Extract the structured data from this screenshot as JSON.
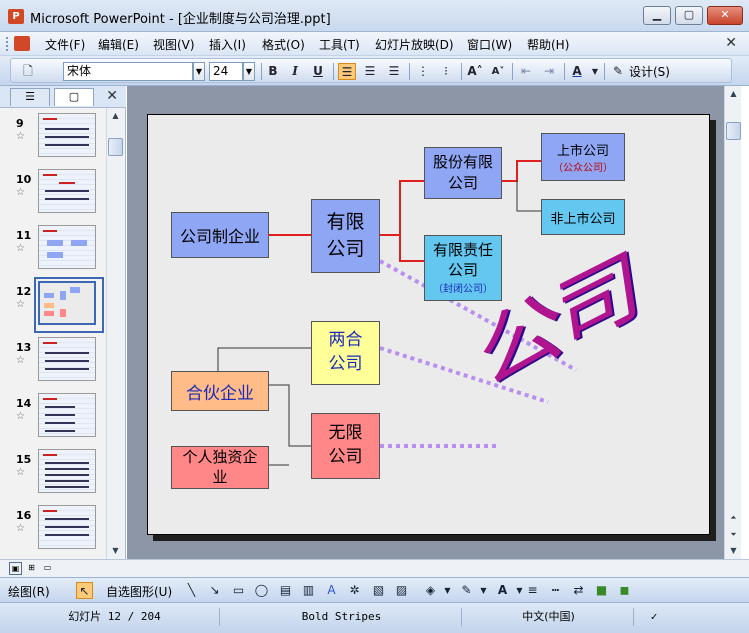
{
  "window": {
    "title": "Microsoft PowerPoint - [企业制度与公司治理.ppt]",
    "app_icon": "P",
    "minimize": "▁",
    "maximize": "▢",
    "close": "✕"
  },
  "menu": {
    "items": [
      "文件(F)",
      "编辑(E)",
      "视图(V)",
      "插入(I)",
      "格式(O)",
      "工具(T)",
      "幻灯片放映(D)",
      "窗口(W)",
      "帮助(H)"
    ],
    "close": "✕"
  },
  "toolbar": {
    "font_name": "宋体",
    "font_size": "24",
    "bold": "B",
    "italic": "I",
    "underline": "U",
    "design_label": "设计(S)"
  },
  "left_panel": {
    "tab_outline": "☰",
    "tab_slides": "▢",
    "close": "✕",
    "slides": [
      {
        "num": "9",
        "star": "☆"
      },
      {
        "num": "10",
        "star": "☆"
      },
      {
        "num": "11",
        "star": "☆"
      },
      {
        "num": "12",
        "star": "☆"
      },
      {
        "num": "13",
        "star": "☆"
      },
      {
        "num": "14",
        "star": "☆"
      },
      {
        "num": "15",
        "star": "☆"
      },
      {
        "num": "16",
        "star": "☆"
      }
    ]
  },
  "slide": {
    "box_company": "公司制企业",
    "box_limited_line1": "有限",
    "box_limited_line2": "公司",
    "box_joint_stock": "股份有限公司",
    "box_listed": "上市公司",
    "box_listed_sub": "（公众公司）",
    "box_unlisted": "非上市公司",
    "box_llc": "有限责任公司",
    "box_llc_sub": "（封闭公司）",
    "box_two_line1": "两合",
    "box_two_line2": "公司",
    "box_partnership": "合伙企业",
    "box_sole": "个人独资企业",
    "box_unlimited_line1": "无限",
    "box_unlimited_line2": "公司",
    "wordart": "公司"
  },
  "drawbar": {
    "draw_label": "绘图(R)",
    "autoshape_label": "自选图形(U)"
  },
  "status": {
    "slide_pos": "幻灯片 12 / 204",
    "theme": "Bold Stripes",
    "language": "中文(中国)"
  },
  "colors": {
    "blue_box": "#8fa6f5",
    "cyan_box": "#63c7ef",
    "yellow_box": "#ffff99",
    "orange_box": "#ffbb88",
    "red_box": "#ff8787",
    "line_red": "#e02020",
    "dotted": "#b88ff0"
  }
}
